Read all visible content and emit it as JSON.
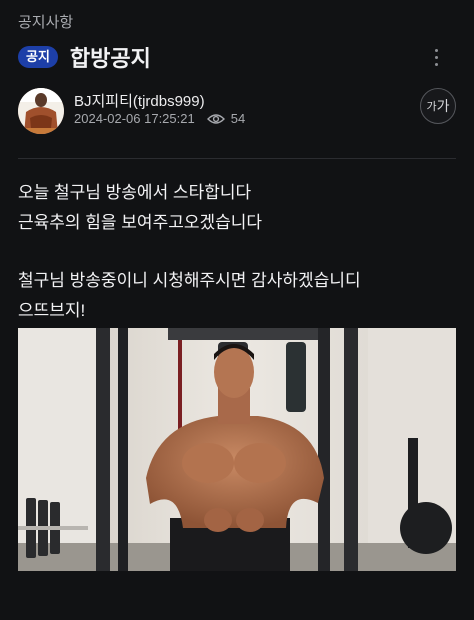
{
  "breadcrumb": "공지사항",
  "post": {
    "badge": "공지",
    "title": "합방공지"
  },
  "author": {
    "name": "BJ지피티(tjrdbs999)",
    "datetime": "2024-02-06 17:25:21",
    "views": "54"
  },
  "font_size_button": {
    "large": "가",
    "small": "가"
  },
  "content": {
    "lines": [
      "오늘 철구님 방송에서 스타합니다",
      "근육추의 힘을 보여주고오겠습니다",
      "",
      "철구님 방송중이니 시청해주시면 감사하겠습니디",
      "으뜨브지!"
    ]
  },
  "icons": {
    "more": "more-vertical-icon",
    "views": "eye-icon"
  },
  "colors": {
    "background": "#111214",
    "badge": "#1d3fa8",
    "muted_text": "#a9abb0"
  }
}
